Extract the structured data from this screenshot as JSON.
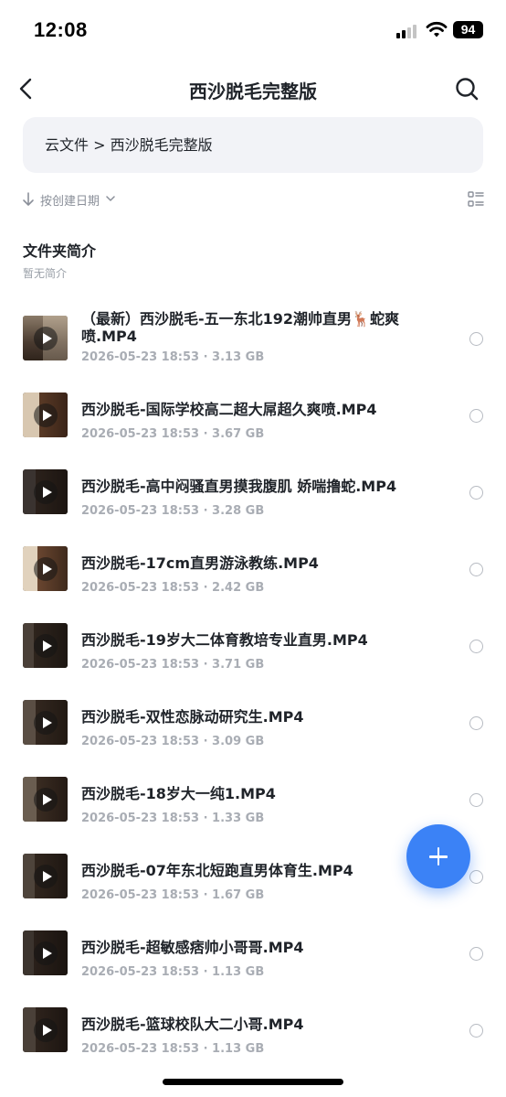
{
  "status_bar": {
    "time": "12:08",
    "battery": "94"
  },
  "nav": {
    "title": "西沙脱毛完整版"
  },
  "breadcrumb": {
    "text": "云文件 > 西沙脱毛完整版"
  },
  "sort": {
    "label": "按创建日期"
  },
  "intro": {
    "title": "文件夹简介",
    "subtitle": "暂无简介"
  },
  "files": [
    {
      "name": "（最新）西沙脱毛-五一东北192潮帅直男🦌蛇爽喷.MP4",
      "meta": "2026-05-23 18:53 · 3.13 GB"
    },
    {
      "name": "西沙脱毛-国际学校高二超大屌超久爽喷.MP4",
      "meta": "2026-05-23 18:53 · 3.67 GB"
    },
    {
      "name": "西沙脱毛-高中闷骚直男摸我腹肌 娇喘撸蛇.MP4",
      "meta": "2026-05-23 18:53 · 3.28 GB"
    },
    {
      "name": "西沙脱毛-17cm直男游泳教练.MP4",
      "meta": "2026-05-23 18:53 · 2.42 GB"
    },
    {
      "name": "西沙脱毛-19岁大二体育教培专业直男.MP4",
      "meta": "2026-05-23 18:53 · 3.71 GB"
    },
    {
      "name": "西沙脱毛-双性恋脉动研究生.MP4",
      "meta": "2026-05-23 18:53 · 3.09 GB"
    },
    {
      "name": "西沙脱毛-18岁大一纯1.MP4",
      "meta": "2026-05-23 18:53 · 1.33 GB"
    },
    {
      "name": "西沙脱毛-07年东北短跑直男体育生.MP4",
      "meta": "2026-05-23 18:53 · 1.67 GB"
    },
    {
      "name": "西沙脱毛-超敏感痞帅小哥哥.MP4",
      "meta": "2026-05-23 18:53 · 1.13 GB"
    },
    {
      "name": "西沙脱毛-篮球校队大二小哥.MP4",
      "meta": "2026-05-23 18:53 · 1.13 GB"
    }
  ],
  "colors": {
    "accent": "#3b82f6",
    "text": "#1f2329",
    "muted": "#a9adb4",
    "breadcrumb_bg": "#f2f3f7"
  },
  "icons": [
    "back-icon",
    "search-icon",
    "sort-arrow-icon",
    "chevron-down-icon",
    "list-view-icon",
    "play-icon",
    "plus-icon"
  ]
}
